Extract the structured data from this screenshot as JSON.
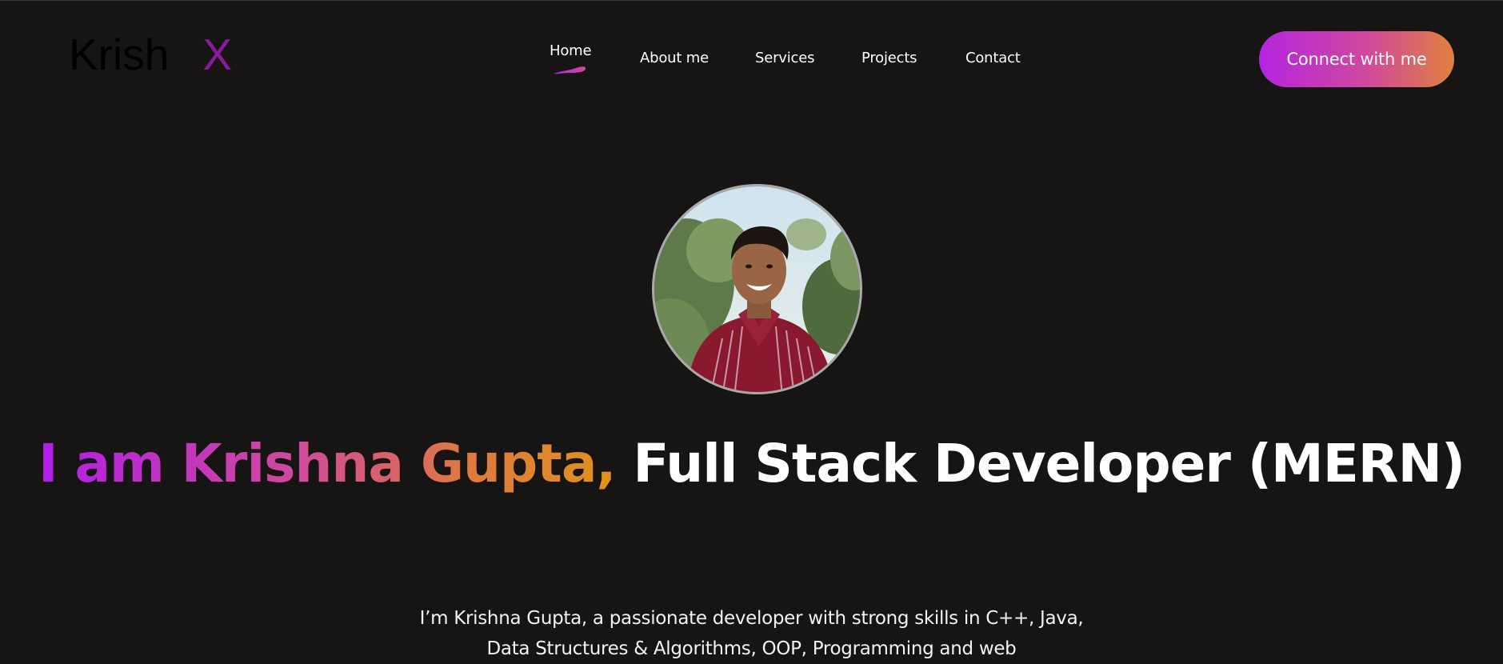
{
  "logo": {
    "text": "Krish",
    "mark": "X"
  },
  "nav": {
    "items": [
      {
        "label": "Home",
        "active": true
      },
      {
        "label": "About me"
      },
      {
        "label": "Services"
      },
      {
        "label": "Projects"
      },
      {
        "label": "Contact"
      }
    ],
    "active_indicator_icon": "brush-underline-icon"
  },
  "cta": {
    "label": "Connect with me"
  },
  "hero": {
    "avatar_alt": "profile-photo",
    "headline_gradient": "I am Krishna Gupta,",
    "headline_rest": "Full Stack Developer (MERN)",
    "description": "I’m Krishna Gupta, a passionate developer with strong skills in C++, Java, Data Structures & Algorithms, OOP, Programming and web"
  },
  "colors": {
    "background": "#161514",
    "gradient_start": "#b425e0",
    "gradient_mid": "#d0489f",
    "gradient_end": "#e0803d",
    "logo_mark": "#8a1a9e"
  }
}
